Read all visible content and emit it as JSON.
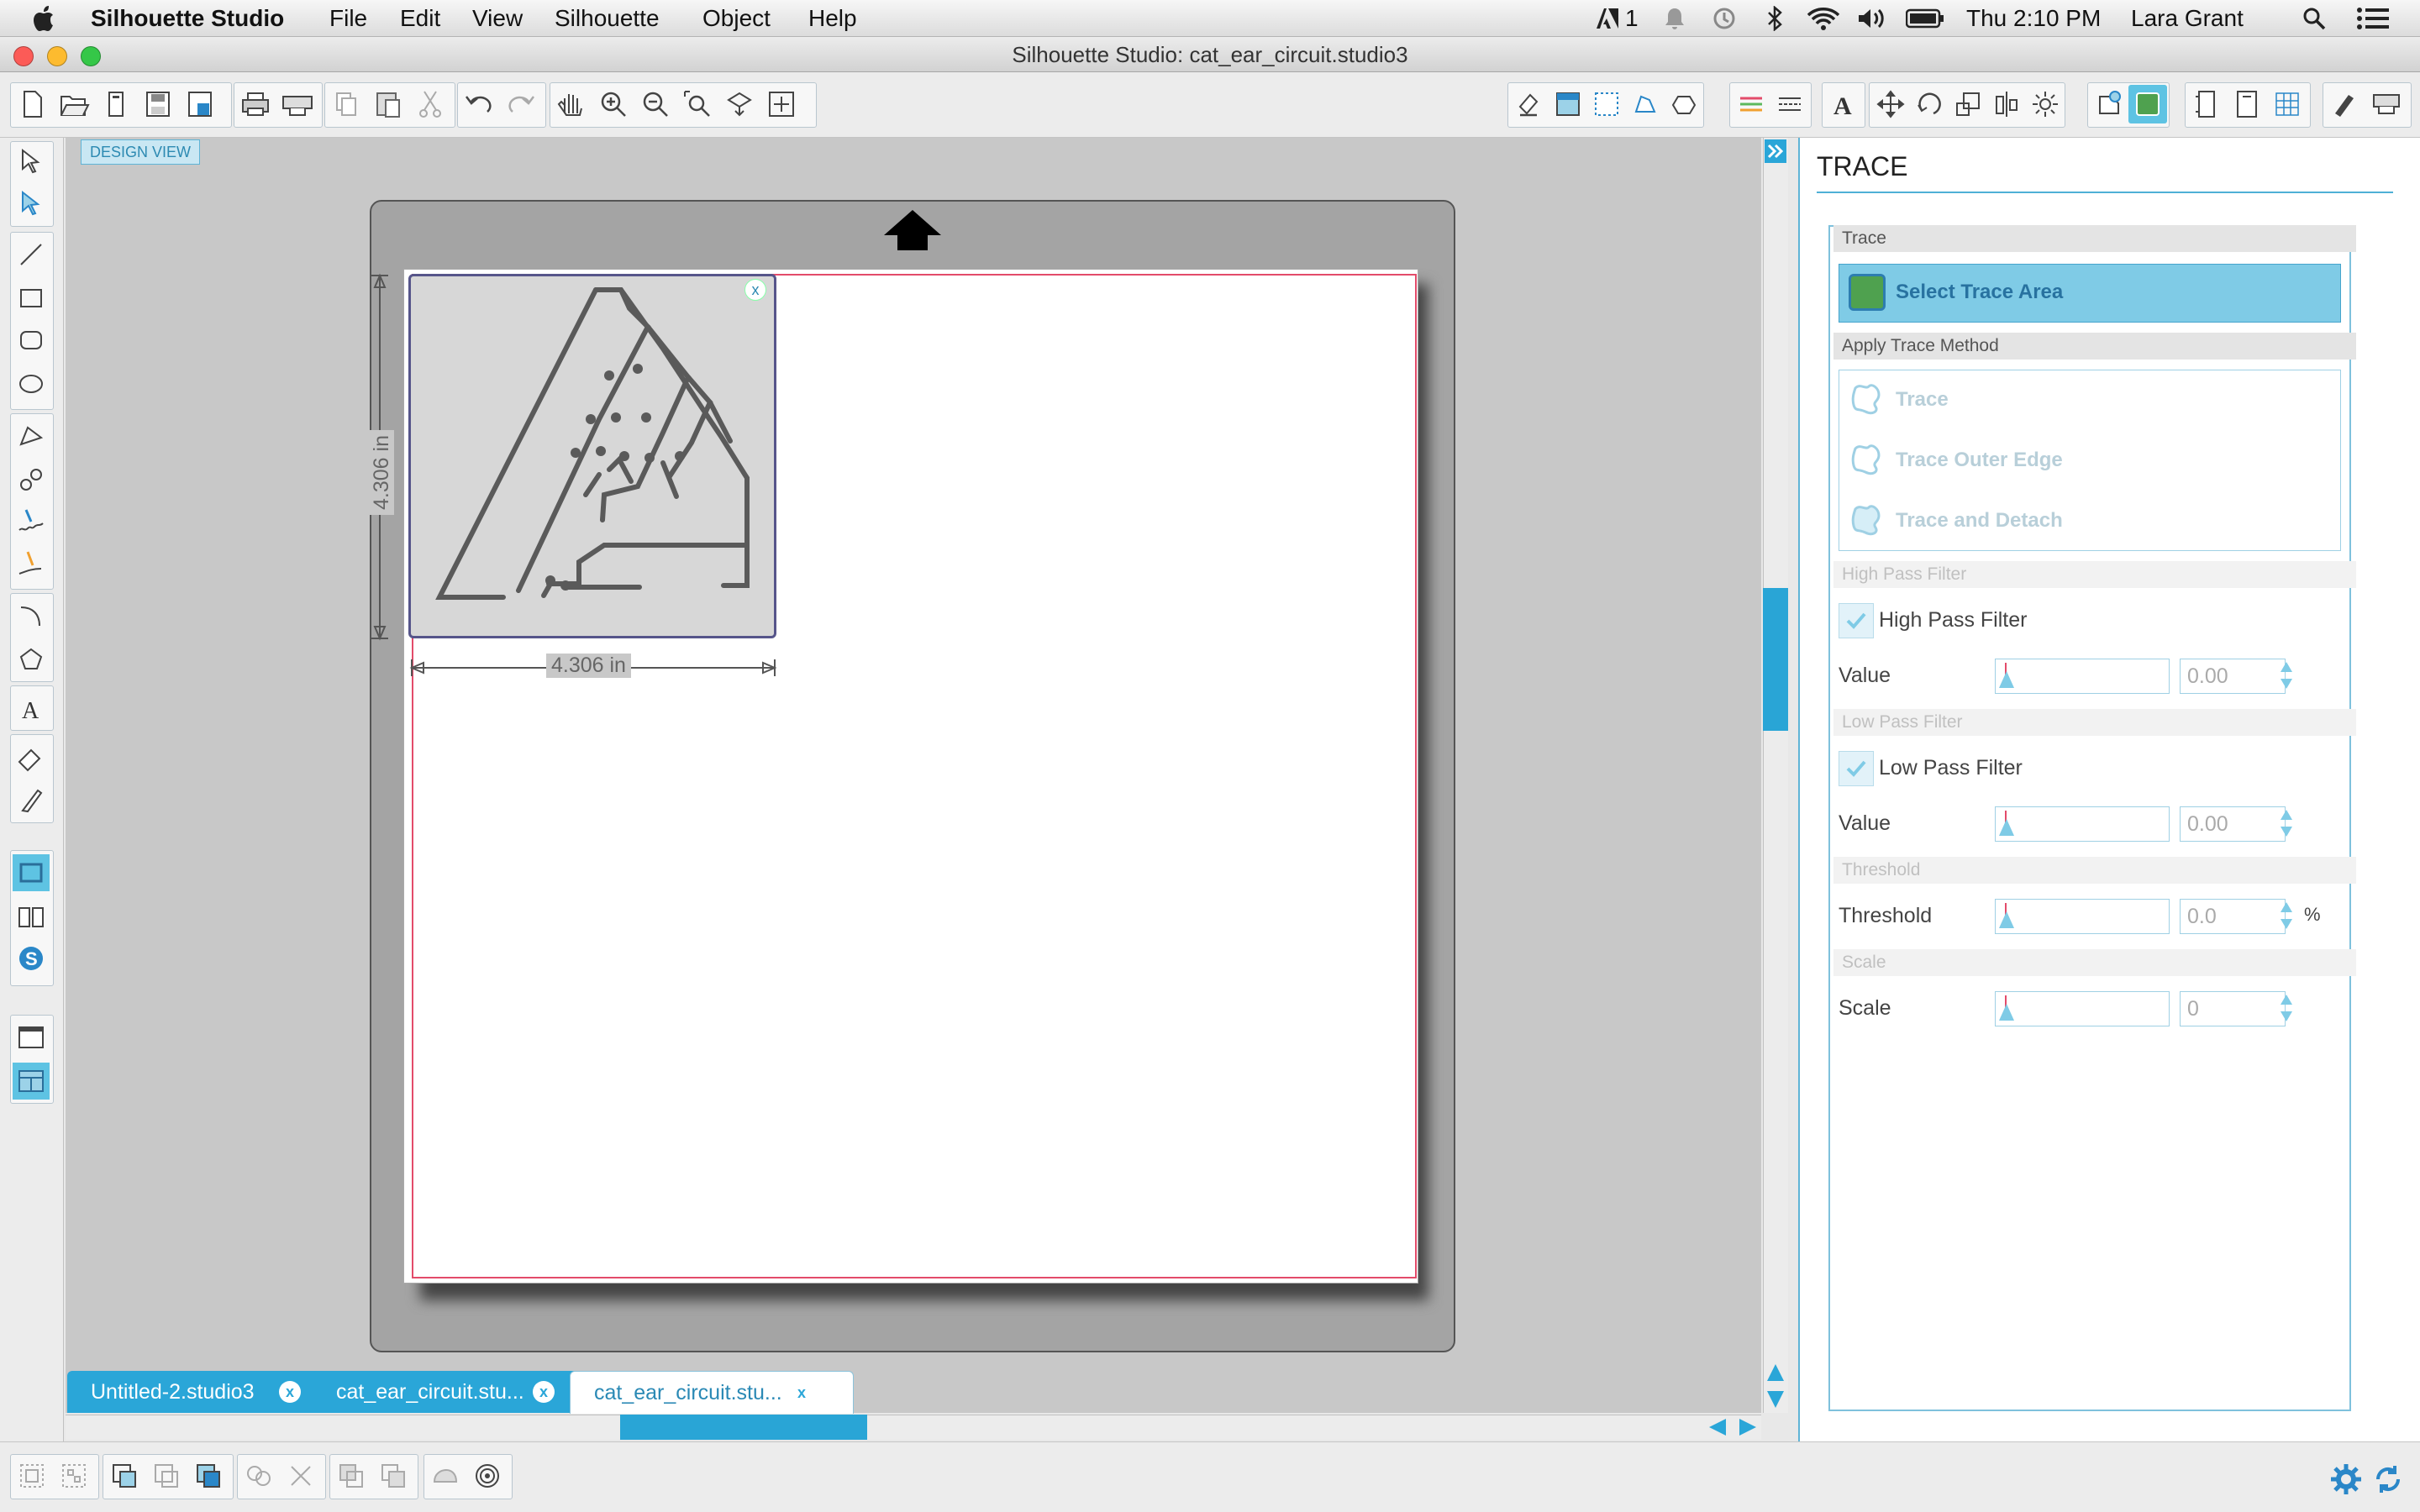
{
  "menubar": {
    "app_name": "Silhouette Studio",
    "items": [
      "File",
      "Edit",
      "View",
      "Silhouette",
      "Object",
      "Help"
    ],
    "status": {
      "adobe_count": "1",
      "clock": "Thu 2:10 PM",
      "user": "Lara Grant"
    }
  },
  "window": {
    "title": "Silhouette Studio: cat_ear_circuit.studio3"
  },
  "canvas": {
    "design_view_label": "DESIGN VIEW",
    "width_dim": "4.306 in",
    "height_dim": "4.306 in",
    "close_glyph": "x"
  },
  "tabs": [
    {
      "label": "Untitled-2.studio3",
      "close": "x"
    },
    {
      "label": "cat_ear_circuit.stu...",
      "close": "x"
    },
    {
      "label": "cat_ear_circuit.stu...",
      "close": "x"
    }
  ],
  "panel": {
    "title": "TRACE",
    "trace_header": "Trace",
    "select_trace_area": "Select Trace Area",
    "apply_method_header": "Apply Trace Method",
    "methods": [
      "Trace",
      "Trace Outer Edge",
      "Trace and Detach"
    ],
    "high_pass_header": "High Pass Filter",
    "high_pass_label": "High Pass Filter",
    "high_pass_value_label": "Value",
    "high_pass_value": "0.00",
    "low_pass_header": "Low Pass Filter",
    "low_pass_label": "Low Pass Filter",
    "low_pass_value_label": "Value",
    "low_pass_value": "0.00",
    "threshold_header": "Threshold",
    "threshold_label": "Threshold",
    "threshold_value": "0.0",
    "threshold_unit": "%",
    "scale_header": "Scale",
    "scale_label": "Scale",
    "scale_value": "0"
  },
  "colors": {
    "accent": "#29a5d6",
    "cut_line": "#e34b6a",
    "image_border": "#56558a"
  }
}
